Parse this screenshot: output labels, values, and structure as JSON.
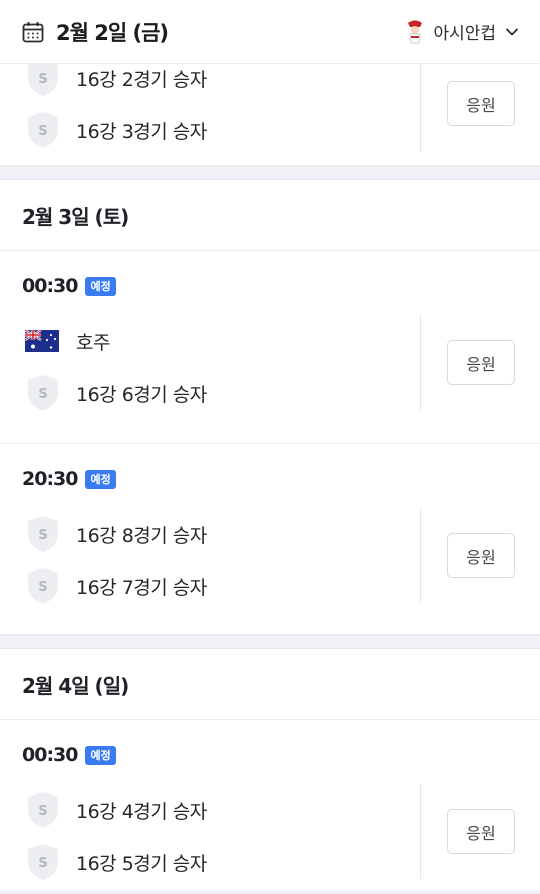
{
  "header": {
    "date": "2월 2일 (금)",
    "league": "아시안컵"
  },
  "colors": {
    "badge": "#3a7bf2",
    "section_gap": "#f0f2f8"
  },
  "sections": [
    {
      "matches": [
        {
          "teams": [
            {
              "name": "16강 2경기 승자",
              "logo": "placeholder-shield-icon"
            },
            {
              "name": "16강 3경기 승자",
              "logo": "placeholder-shield-icon"
            }
          ],
          "cheer_label": "응원"
        }
      ]
    },
    {
      "day": "2월 3일 (토)",
      "matches": [
        {
          "time": "00:30",
          "status": "예정",
          "teams": [
            {
              "name": "호주",
              "logo": "australia-flag-icon"
            },
            {
              "name": "16강 6경기 승자",
              "logo": "placeholder-shield-icon"
            }
          ],
          "cheer_label": "응원"
        },
        {
          "time": "20:30",
          "status": "예정",
          "teams": [
            {
              "name": "16강 8경기 승자",
              "logo": "placeholder-shield-icon"
            },
            {
              "name": "16강 7경기 승자",
              "logo": "placeholder-shield-icon"
            }
          ],
          "cheer_label": "응원"
        }
      ]
    },
    {
      "day": "2월 4일 (일)",
      "matches": [
        {
          "time": "00:30",
          "status": "예정",
          "teams": [
            {
              "name": "16강 4경기 승자",
              "logo": "placeholder-shield-icon"
            },
            {
              "name": "16강 5경기 승자",
              "logo": "placeholder-shield-icon"
            }
          ],
          "cheer_label": "응원"
        }
      ]
    }
  ]
}
